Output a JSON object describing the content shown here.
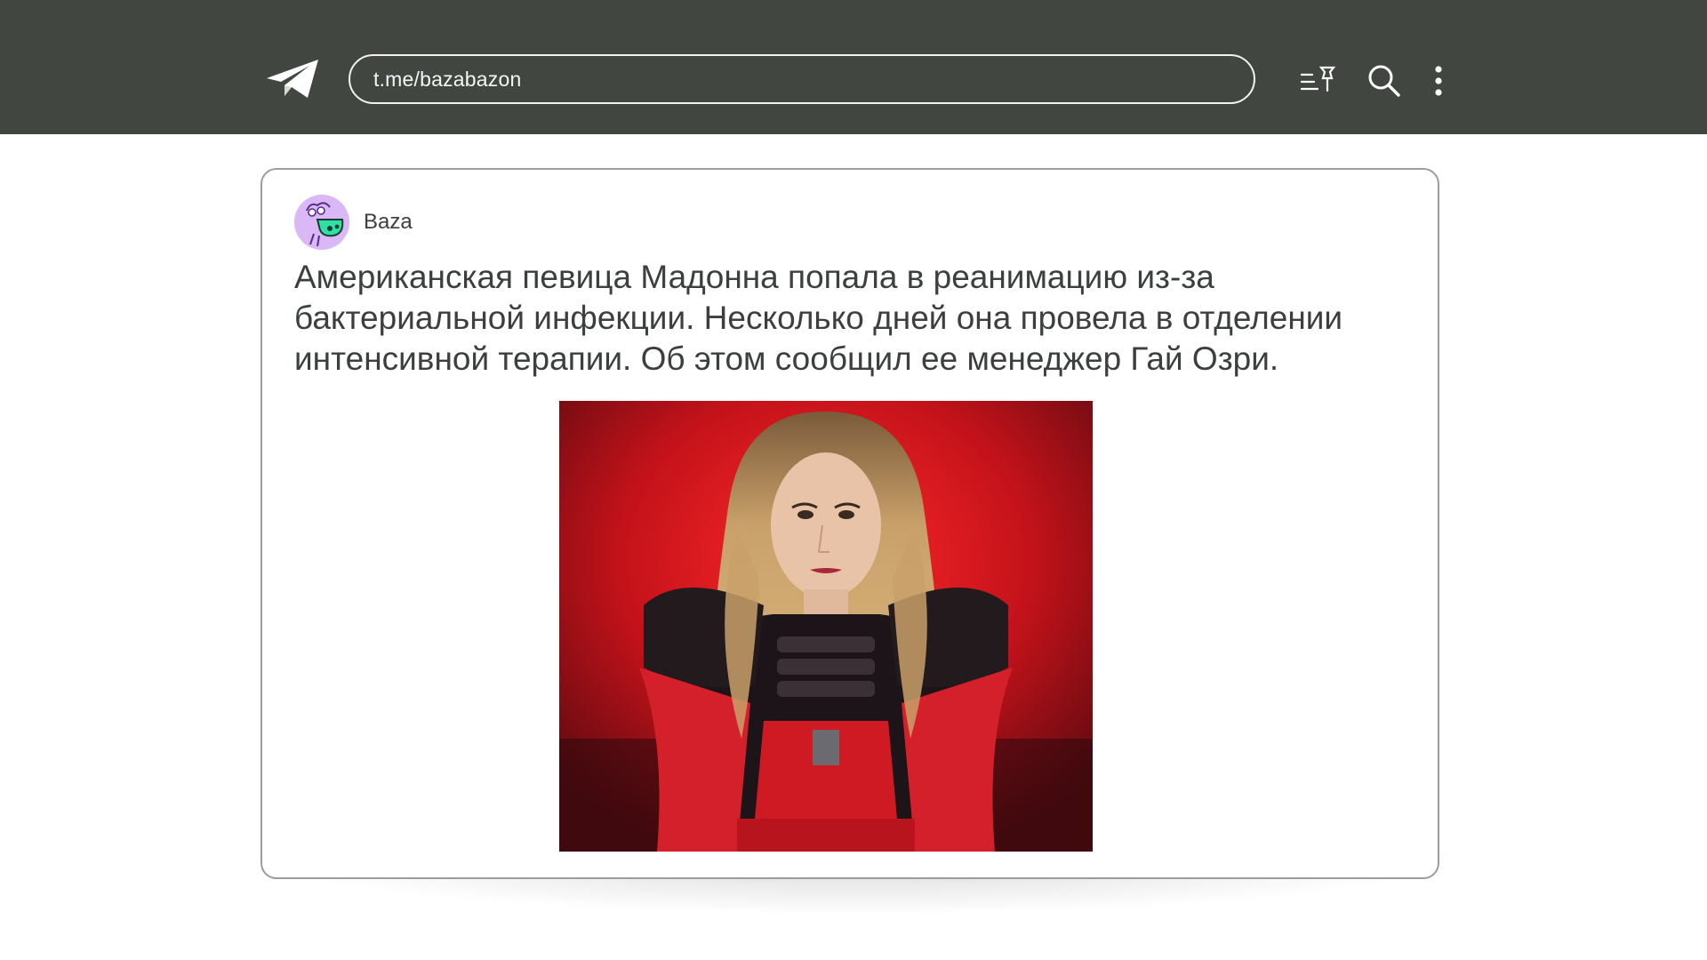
{
  "header": {
    "url": "t.me/bazabazon",
    "icons": [
      "telegram-logo-icon",
      "pinned-messages-icon",
      "search-icon",
      "more-options-icon"
    ],
    "background_color": "#414641"
  },
  "post": {
    "channel_name": "Baza",
    "text": "Американская певица Мадонна попала в реанимацию из-за бактериальной инфекции. Несколько дней она провела в отделении интенсивной терапии. Об этом сообщил ее менеджер Гай Озри.",
    "avatar_color": "#d9b8f5",
    "image_subject": "performer-on-stage-photo"
  }
}
